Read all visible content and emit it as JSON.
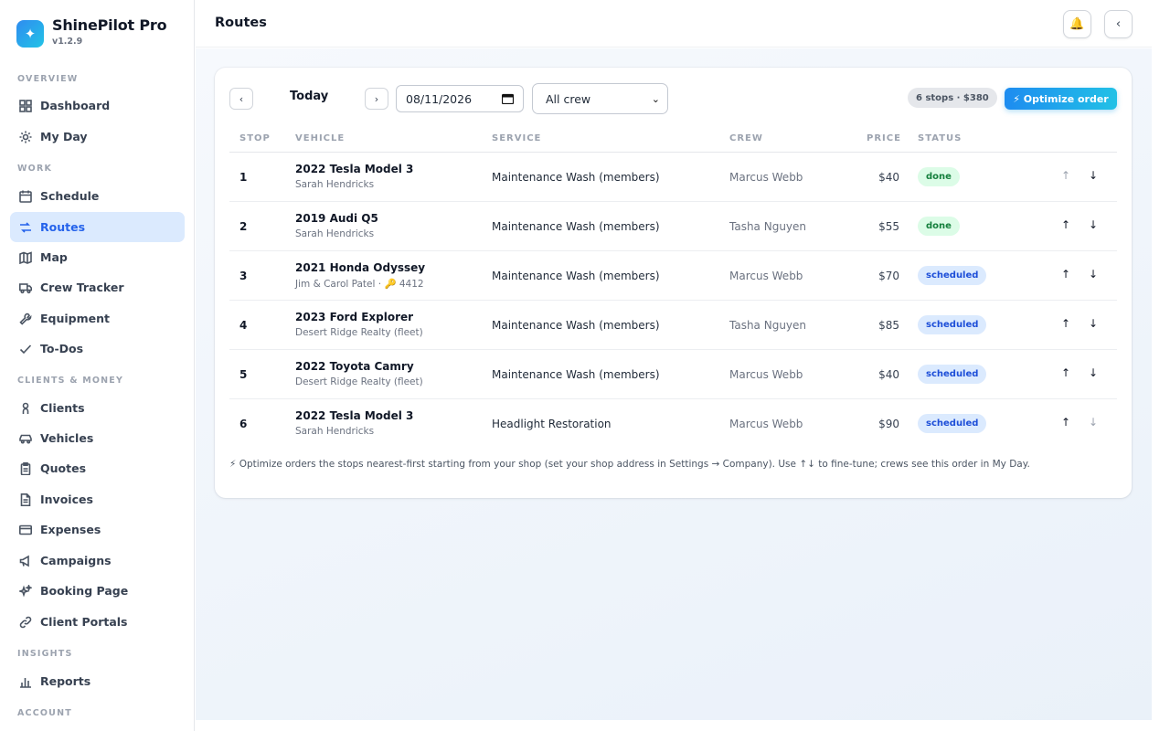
{
  "app": {
    "name": "ShinePilot Pro",
    "version": "v1.2.9",
    "logo_icon": "sparkle-icon",
    "accent": "#2563eb"
  },
  "sidebar": {
    "sections": [
      {
        "label": "OVERVIEW",
        "items": [
          {
            "label": "Dashboard",
            "icon": "dashboard-icon"
          },
          {
            "label": "My Day",
            "icon": "sun-icon"
          }
        ]
      },
      {
        "label": "WORK",
        "items": [
          {
            "label": "Schedule",
            "icon": "calendar-icon"
          },
          {
            "label": "Routes",
            "icon": "route-icon",
            "active": true
          },
          {
            "label": "Map",
            "icon": "map-icon"
          },
          {
            "label": "Crew Tracker",
            "icon": "truck-icon"
          },
          {
            "label": "Equipment",
            "icon": "wrench-icon"
          },
          {
            "label": "To-Dos",
            "icon": "check-icon"
          }
        ]
      },
      {
        "label": "CLIENTS & MONEY",
        "items": [
          {
            "label": "Clients",
            "icon": "person-icon"
          },
          {
            "label": "Vehicles",
            "icon": "car-icon"
          },
          {
            "label": "Quotes",
            "icon": "clipboard-icon"
          },
          {
            "label": "Invoices",
            "icon": "invoice-icon"
          },
          {
            "label": "Expenses",
            "icon": "card-icon"
          },
          {
            "label": "Campaigns",
            "icon": "megaphone-icon"
          },
          {
            "label": "Booking Page",
            "icon": "sparkles-icon"
          },
          {
            "label": "Client Portals",
            "icon": "link-icon"
          }
        ]
      },
      {
        "label": "INSIGHTS",
        "items": [
          {
            "label": "Reports",
            "icon": "bar-chart-icon"
          }
        ]
      },
      {
        "label": "ACCOUNT",
        "items": []
      }
    ]
  },
  "header": {
    "title": "Routes",
    "bell_icon": "🔔",
    "collapse_icon": "‹"
  },
  "toolbar": {
    "prev_label": "‹",
    "next_label": "›",
    "today_label": "Today",
    "date_value": "08/11/2026",
    "crew_filter": "All crew",
    "summary": "6 stops · $380",
    "optimize_label": "⚡ Optimize order"
  },
  "table": {
    "headers": {
      "stop": "STOP",
      "vehicle": "VEHICLE",
      "service": "SERVICE",
      "crew": "CREW",
      "price": "PRICE",
      "status": "STATUS"
    },
    "move_up": "↑",
    "move_down": "↓",
    "rows": [
      {
        "stop": "1",
        "vehicle": "2022 Tesla Model 3",
        "owner": "Sarah Hendricks",
        "service": "Maintenance Wash (members)",
        "crew": "Marcus Webb",
        "price": "$40",
        "status": "done",
        "up_disabled": true,
        "down_disabled": false
      },
      {
        "stop": "2",
        "vehicle": "2019 Audi Q5",
        "owner": "Sarah Hendricks",
        "service": "Maintenance Wash (members)",
        "crew": "Tasha Nguyen",
        "price": "$55",
        "status": "done",
        "up_disabled": false,
        "down_disabled": false
      },
      {
        "stop": "3",
        "vehicle": "2021 Honda Odyssey",
        "owner": "Jim & Carol Patel · 🔑 4412",
        "service": "Maintenance Wash (members)",
        "crew": "Marcus Webb",
        "price": "$70",
        "status": "scheduled",
        "up_disabled": false,
        "down_disabled": false
      },
      {
        "stop": "4",
        "vehicle": "2023 Ford Explorer",
        "owner": "Desert Ridge Realty (fleet)",
        "service": "Maintenance Wash (members)",
        "crew": "Tasha Nguyen",
        "price": "$85",
        "status": "scheduled",
        "up_disabled": false,
        "down_disabled": false
      },
      {
        "stop": "5",
        "vehicle": "2022 Toyota Camry",
        "owner": "Desert Ridge Realty (fleet)",
        "service": "Maintenance Wash (members)",
        "crew": "Marcus Webb",
        "price": "$40",
        "status": "scheduled",
        "up_disabled": false,
        "down_disabled": false
      },
      {
        "stop": "6",
        "vehicle": "2022 Tesla Model 3",
        "owner": "Sarah Hendricks",
        "service": "Headlight Restoration",
        "crew": "Marcus Webb",
        "price": "$90",
        "status": "scheduled",
        "up_disabled": false,
        "down_disabled": true
      }
    ]
  },
  "footnote": "⚡ Optimize orders the stops nearest-first starting from your shop (set your shop address in Settings → Company). Use ↑↓ to fine-tune; crews see this order in My Day."
}
